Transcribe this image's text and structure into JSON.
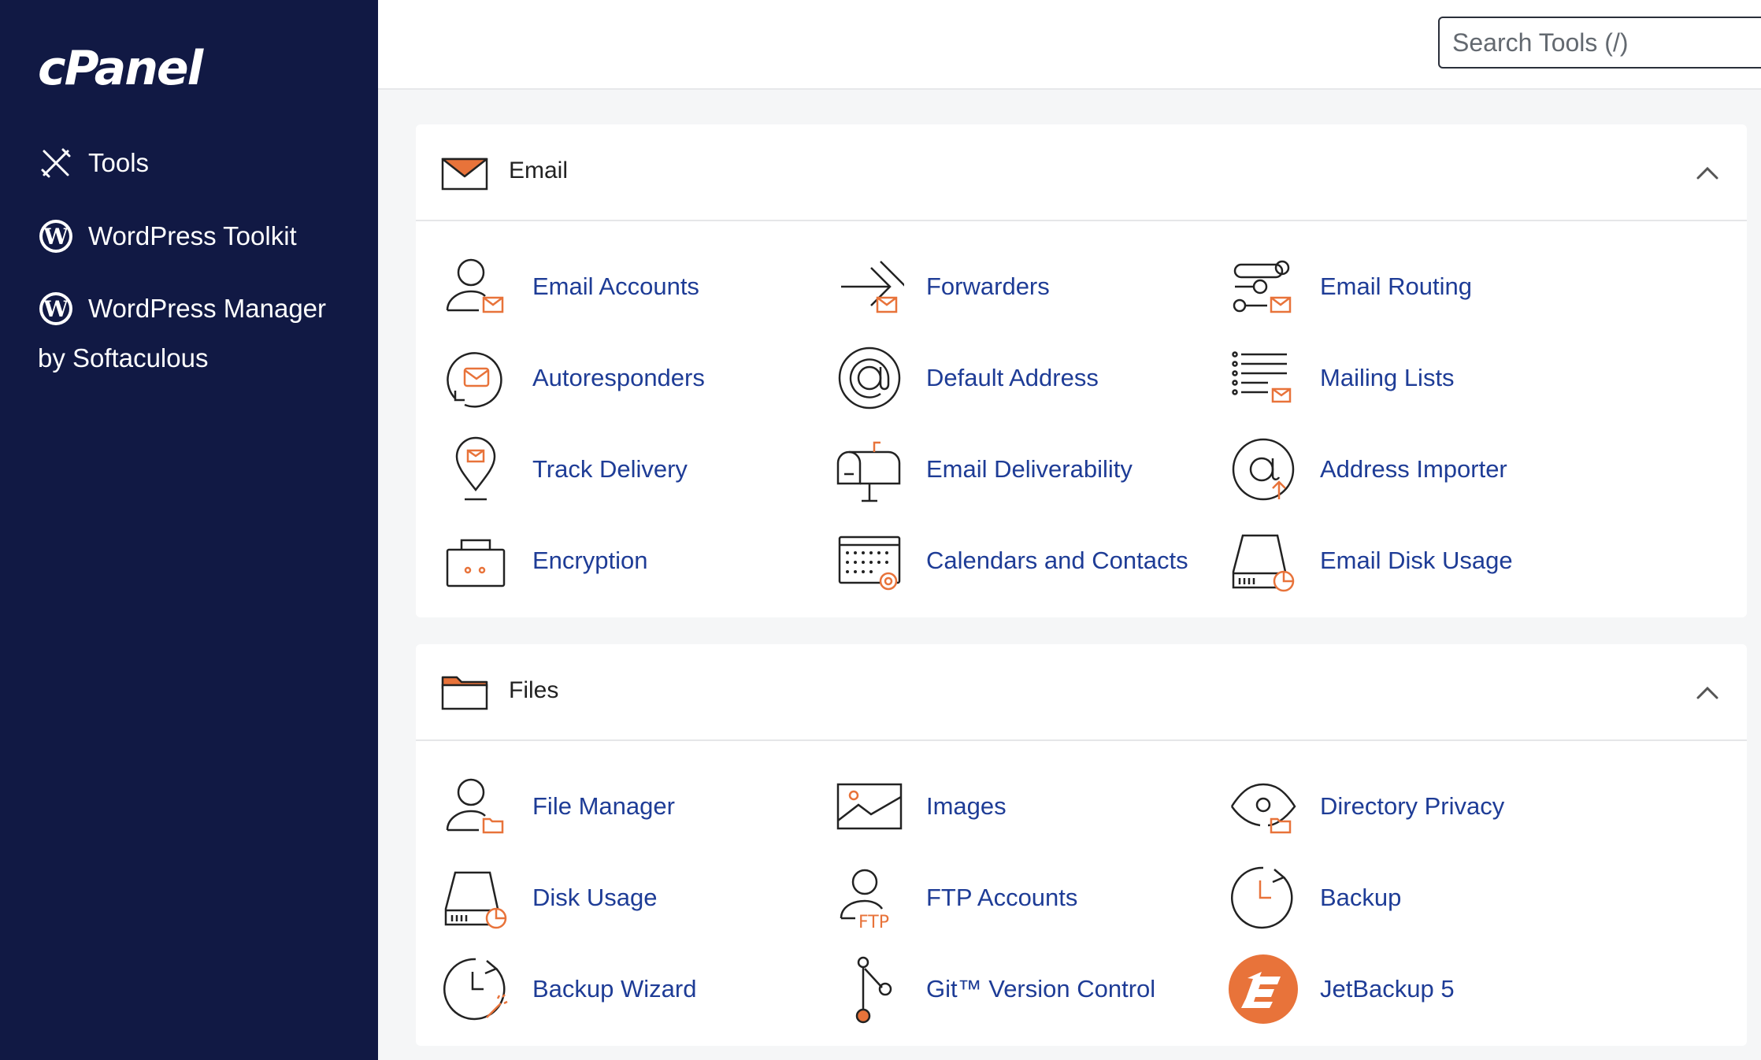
{
  "sidebar": {
    "logo": "cPanel",
    "items": [
      {
        "label": "Tools",
        "icon": "tools-icon"
      },
      {
        "label": "WordPress Toolkit",
        "icon": "wordpress-icon"
      },
      {
        "label": "WordPress Manager",
        "icon": "wordpress-icon"
      }
    ],
    "wpm_sub": "by Softaculous"
  },
  "header": {
    "search_placeholder": "Search Tools (/)"
  },
  "colors": {
    "sidebar": "#111944",
    "link": "#1e3c96",
    "accent": "#e8733a"
  },
  "email": {
    "title": "Email",
    "tools": [
      {
        "label": "Email Accounts",
        "icon": "user-mail-icon"
      },
      {
        "label": "Forwarders",
        "icon": "forward-arrow-icon"
      },
      {
        "label": "Email Routing",
        "icon": "routing-icon"
      },
      {
        "label": "Autoresponders",
        "icon": "autoresponder-icon"
      },
      {
        "label": "Default Address",
        "icon": "at-sign-icon"
      },
      {
        "label": "Mailing Lists",
        "icon": "list-mail-icon"
      },
      {
        "label": "Track Delivery",
        "icon": "location-pin-icon"
      },
      {
        "label": "Email Deliverability",
        "icon": "mailbox-icon"
      },
      {
        "label": "Address Importer",
        "icon": "at-import-icon"
      },
      {
        "label": "Encryption",
        "icon": "lock-icon"
      },
      {
        "label": "Calendars and Contacts",
        "icon": "calendar-icon"
      },
      {
        "label": "Email Disk Usage",
        "icon": "disk-icon"
      }
    ]
  },
  "files": {
    "title": "Files",
    "tools": [
      {
        "label": "File Manager",
        "icon": "user-folder-icon"
      },
      {
        "label": "Images",
        "icon": "image-icon"
      },
      {
        "label": "Directory Privacy",
        "icon": "eye-folder-icon"
      },
      {
        "label": "Disk Usage",
        "icon": "disk-icon"
      },
      {
        "label": "FTP Accounts",
        "icon": "user-ftp-icon"
      },
      {
        "label": "Backup",
        "icon": "clock-restore-icon"
      },
      {
        "label": "Backup Wizard",
        "icon": "clock-wand-icon"
      },
      {
        "label": "Git™ Version Control",
        "icon": "git-branch-icon"
      },
      {
        "label": "JetBackup 5",
        "icon": "jetbackup-icon"
      }
    ]
  }
}
